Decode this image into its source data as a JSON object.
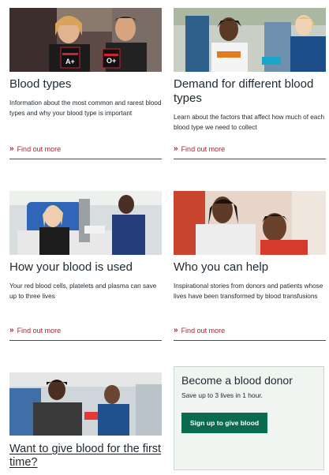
{
  "cards": [
    {
      "title": "Blood types",
      "description": "Information about the most common and rarest blood types and why your blood type is important",
      "link_label": "Find out more",
      "image_alt": "two people holding blood type cards",
      "image_text": [
        "A+",
        "O+"
      ]
    },
    {
      "title": "Demand for different blood types",
      "description": "Learn about the factors that affect how much of each blood type we need to collect",
      "link_label": "Find out more",
      "image_alt": "smiling donor with nurse"
    },
    {
      "title": "How your blood is used",
      "description": "Your red blood cells, platelets and plasma can save up to three lives",
      "link_label": "Find out more",
      "image_alt": "patient with nurse in hospital"
    },
    {
      "title": "Who you can help",
      "description": "Inspirational stories from donors and patients whose lives have been transformed by blood transfusions",
      "link_label": "Find out more",
      "image_alt": "mother and son smiling"
    },
    {
      "title": "Want to give blood for the first time?",
      "image_alt": "donor giving blood with nurse"
    }
  ],
  "donor_box": {
    "title": "Become a blood donor",
    "subtitle": "Save up to 3 lives in 1 hour.",
    "button_label": "Sign up to give blood"
  },
  "colors": {
    "link_red": "#bd1a2e",
    "button_green": "#0a6b4f",
    "box_background": "#f0f5f2"
  },
  "icons": [
    "chevron-right-double-icon"
  ]
}
